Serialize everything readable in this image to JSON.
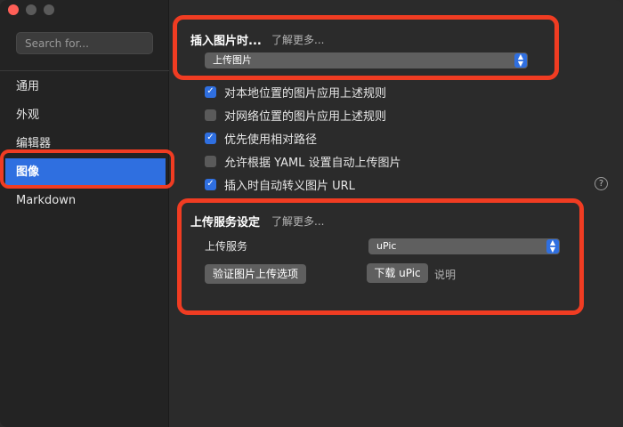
{
  "sidebar": {
    "search_placeholder": "Search for...",
    "items": [
      {
        "label": "通用"
      },
      {
        "label": "外观"
      },
      {
        "label": "编辑器"
      },
      {
        "label": "图像",
        "active": true
      },
      {
        "label": "Markdown"
      }
    ]
  },
  "insert_section": {
    "title": "插入图片时...",
    "learn_more": "了解更多...",
    "selected_option": "上传图片"
  },
  "checkboxes": [
    {
      "label": "对本地位置的图片应用上述规则",
      "checked": true
    },
    {
      "label": "对网络位置的图片应用上述规则",
      "checked": false
    },
    {
      "label": "优先使用相对路径",
      "checked": true
    },
    {
      "label": "允许根据 YAML 设置自动上传图片",
      "checked": false
    },
    {
      "label": "插入时自动转义图片 URL",
      "checked": true
    }
  ],
  "help_label": "?",
  "upload_section": {
    "title": "上传服务设定",
    "learn_more": "了解更多...",
    "service_label": "上传服务",
    "service_value": "uPic",
    "verify_button": "验证图片上传选项",
    "download_button": "下载 uPic",
    "explain_link": "说明"
  },
  "colors": {
    "accent": "#2f6fe0",
    "highlight": "#f03c22",
    "close": "#ff5f57"
  },
  "icons": {
    "check": "✓",
    "chevron": "⌃⌄"
  }
}
